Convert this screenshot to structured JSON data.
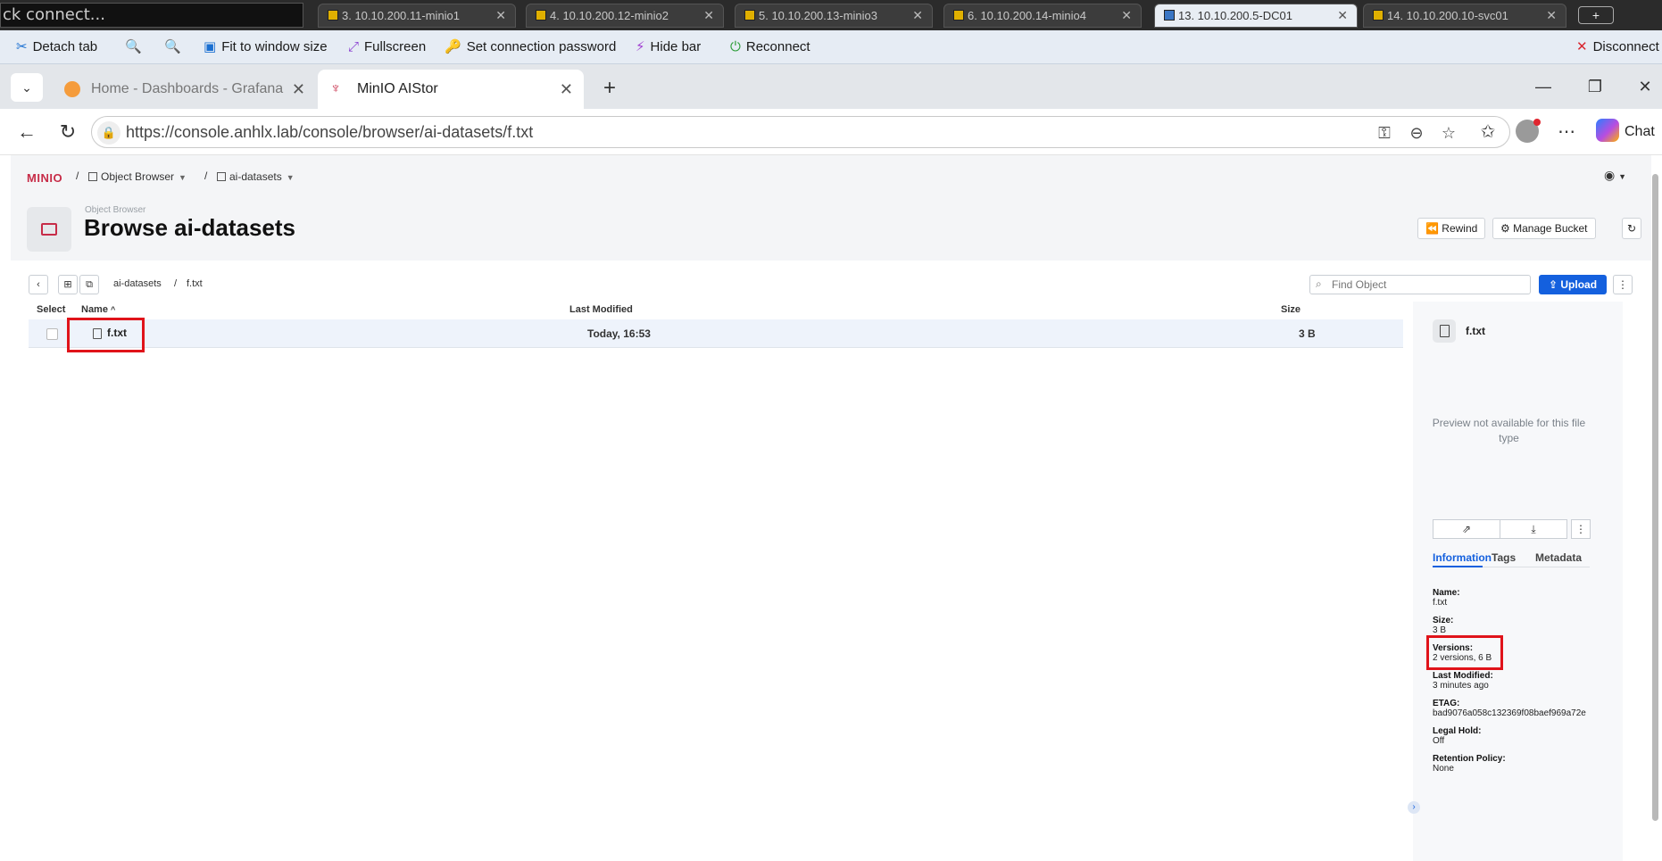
{
  "rdp": {
    "search_placeholder": "ck connect...",
    "tabs": [
      {
        "label": "3. 10.10.200.11-minio1"
      },
      {
        "label": "4. 10.10.200.12-minio2"
      },
      {
        "label": "5. 10.10.200.13-minio3"
      },
      {
        "label": "6. 10.10.200.14-minio4"
      },
      {
        "label": "13. 10.10.200.5-DC01"
      },
      {
        "label": "14. 10.10.200.10-svc01"
      }
    ],
    "new_tab_label": "+",
    "toolbar": {
      "detach": "Detach tab",
      "fit": "Fit to window size",
      "fullscreen": "Fullscreen",
      "set_password": "Set connection password",
      "hide_bar": "Hide bar",
      "reconnect": "Reconnect",
      "disconnect": "Disconnect"
    }
  },
  "edge": {
    "tabs": [
      {
        "label": "Home - Dashboards - Grafana"
      },
      {
        "label": "MinIO AIStor"
      }
    ],
    "url": "https://console.anhlx.lab/console/browser/ai-datasets/f.txt",
    "copilot_label": "Chat"
  },
  "minio": {
    "logo": "MINIO",
    "breadcrumb": {
      "object_browser": "Object Browser",
      "bucket": "ai-datasets",
      "sep": "/"
    },
    "page_kicker": "Object Browser",
    "page_title": "Browse ai-datasets",
    "buttons": {
      "rewind": "Rewind",
      "manage_bucket": "Manage Bucket",
      "upload": "Upload"
    },
    "path": {
      "bucket": "ai-datasets",
      "sep": "/",
      "file": "f.txt"
    },
    "find_placeholder": "Find Object",
    "table": {
      "headers": {
        "select": "Select",
        "name": "Name",
        "modified": "Last Modified",
        "size": "Size"
      },
      "rows": [
        {
          "name": "f.txt",
          "modified": "Today, 16:53",
          "size": "3 B"
        }
      ]
    },
    "detail": {
      "filename": "f.txt",
      "preview_msg": "Preview not available for this file type",
      "tabs": [
        "Information",
        "Tags",
        "Metadata"
      ],
      "info": [
        {
          "label": "Name:",
          "value": "f.txt"
        },
        {
          "label": "Size:",
          "value": "3 B"
        },
        {
          "label": "Versions:",
          "value": "2 versions, 6 B"
        },
        {
          "label": "Last Modified:",
          "value": "3 minutes ago"
        },
        {
          "label": "ETAG:",
          "value": "bad9076a058c132369f08baef969a72e"
        },
        {
          "label": "Legal Hold:",
          "value": "Off"
        },
        {
          "label": "Retention Policy:",
          "value": "None"
        }
      ]
    }
  },
  "colors": {
    "accent": "#1460de",
    "brand": "#c72c48",
    "highlight": "#e0131a"
  }
}
